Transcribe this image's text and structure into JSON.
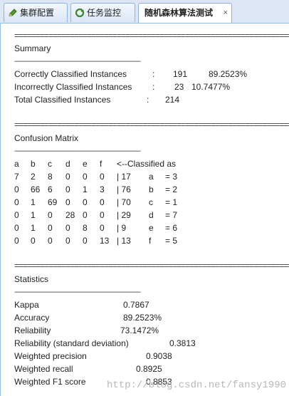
{
  "tabs": [
    {
      "label": "集群配置",
      "icon": "pencil-icon"
    },
    {
      "label": "任务监控",
      "icon": "refresh-icon"
    },
    {
      "label": "随机森林算法测试",
      "close": "×"
    }
  ],
  "summary": {
    "heading": "Summary",
    "rows": [
      {
        "label": "Correctly Classified Instances",
        "sep": ":",
        "count": "191",
        "pct": "89.2523%"
      },
      {
        "label": "Incorrectly Classified Instances",
        "sep": ":",
        "count": "23",
        "pct": "10.7477%"
      },
      {
        "label": "Total Classified Instances",
        "sep": ":",
        "count": "214",
        "pct": ""
      }
    ]
  },
  "confusion": {
    "heading": "Confusion Matrix",
    "header": {
      "cols": [
        "a",
        "b",
        "c",
        "d",
        "e",
        "f"
      ],
      "classified": "<--Classified as"
    },
    "rows": [
      {
        "v": [
          "7",
          "2",
          "8",
          "0",
          "0",
          "0"
        ],
        "total": "| 17",
        "cls": "a",
        "eq": "= 3"
      },
      {
        "v": [
          "0",
          "66",
          "6",
          "0",
          "1",
          "3"
        ],
        "total": "| 76",
        "cls": "b",
        "eq": "= 2"
      },
      {
        "v": [
          "0",
          "1",
          "69",
          "0",
          "0",
          "0"
        ],
        "total": "| 70",
        "cls": "c",
        "eq": "= 1"
      },
      {
        "v": [
          "0",
          "1",
          "0",
          "28",
          "0",
          "0"
        ],
        "total": "| 29",
        "cls": "d",
        "eq": "= 7"
      },
      {
        "v": [
          "0",
          "1",
          "0",
          "0",
          "8",
          "0"
        ],
        "total": "| 9",
        "cls": "e",
        "eq": "= 6"
      },
      {
        "v": [
          "0",
          "0",
          "0",
          "0",
          "0",
          "13"
        ],
        "total": "| 13",
        "cls": "f",
        "eq": "= 5"
      }
    ]
  },
  "statistics": {
    "heading": "Statistics",
    "rows": [
      {
        "label": "Kappa",
        "value": "0.7867"
      },
      {
        "label": "Accuracy",
        "value": "89.2523%"
      },
      {
        "label": "Reliability",
        "value": "73.1472%"
      },
      {
        "label": "Reliability (standard deviation)",
        "value": "0.3813"
      },
      {
        "label": "Weighted precision",
        "value": "0.9038"
      },
      {
        "label": "Weighted recall",
        "value": "0.8925"
      },
      {
        "label": "Weighted F1 score",
        "value": "0.8853"
      }
    ]
  },
  "rules": {
    "eq": "==================================================================",
    "dash": "----------------------------------------------------------------------------"
  },
  "watermark": "http://blog.csdn.net/fansy1990"
}
